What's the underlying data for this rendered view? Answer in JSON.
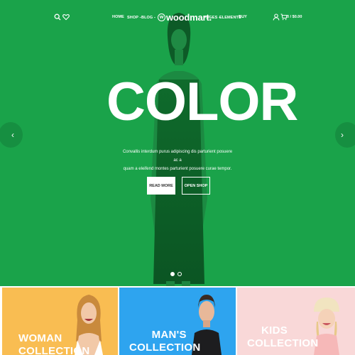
{
  "header": {
    "nav_left": [
      "HOME",
      "SHOP",
      "BLOG"
    ],
    "nav_right": [
      "PAGES",
      "ELEMENTS",
      "BUY"
    ],
    "logo": "woodmart.",
    "logo_mark": "w",
    "cart_total": "0 / $0.00",
    "icons": [
      "search-icon",
      "heart-icon",
      "user-icon",
      "cart-icon"
    ]
  },
  "hero": {
    "headline": "COLOR",
    "subtext_line1": "Convallis interdum purus adipiscing dis parturient posuere ac a",
    "subtext_line2": "quam a eleifend montes parturient posuere curae tempor.",
    "button_primary": "READ MORE",
    "button_secondary": "OPEN SHOP",
    "arrow_left": "‹",
    "arrow_right": "›",
    "slide_count": 2,
    "active_slide": 1,
    "background_color": "#1aa34a"
  },
  "collections": [
    {
      "line1": "WOMAN",
      "line2": "COLLECTION",
      "color": "#f9bd52"
    },
    {
      "line1": "MAN'S",
      "line2": "COLLECTION",
      "color": "#2ea4ef"
    },
    {
      "line1": "KIDS",
      "line2": "COLLECTION",
      "color": "#f9d8d8"
    }
  ]
}
